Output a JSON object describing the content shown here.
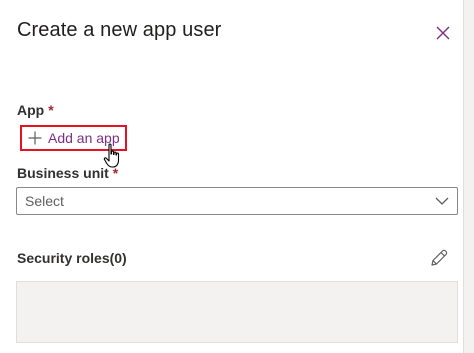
{
  "panel": {
    "title": "Create a new app user"
  },
  "app_field": {
    "label": "App",
    "required_mark": "*",
    "add_button_label": "Add an app"
  },
  "business_unit": {
    "label": "Business unit",
    "required_mark": "*",
    "selected_value": "Select"
  },
  "security_roles": {
    "label": "Security roles(0)"
  },
  "colors": {
    "accent": "#7e2e84",
    "highlight_border": "#e81123",
    "required": "#a4262c"
  },
  "icons": [
    "close-icon",
    "plus-icon",
    "hand-pointer-cursor",
    "chevron-down-icon",
    "pencil-icon"
  ]
}
